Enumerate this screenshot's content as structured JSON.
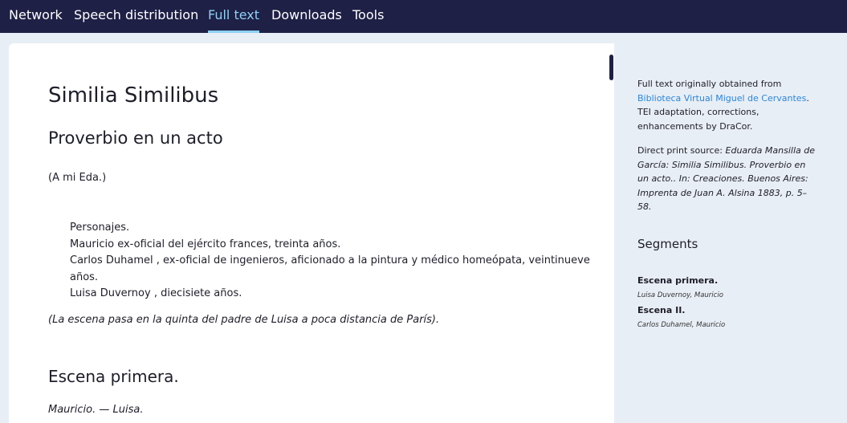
{
  "nav": {
    "tabs": [
      {
        "label": "Network"
      },
      {
        "label": "Speech distribution"
      },
      {
        "label": "Full text",
        "active": true
      },
      {
        "label": "Downloads"
      },
      {
        "label": "Tools"
      }
    ]
  },
  "play": {
    "title": "Similia Similibus",
    "subtitle": "Proverbio en un acto",
    "dedication": "(A mi Eda.)",
    "cast": [
      "Personajes.",
      "Mauricio ex-oficial del ejército frances, treinta años.",
      "Carlos Duhamel , ex-oficial de ingenieros, aficionado a la pintura y médico homeópata, veintinueve años.",
      "Luisa Duvernoy , diecisiete años."
    ],
    "set": "(La escena pasa en la quinta del padre de Luisa a poca distancia de París).",
    "scene_heading": "Escena primera.",
    "speakers": "Mauricio. — Luisa."
  },
  "source": {
    "intro": "Full text originally obtained from",
    "link": "Biblioteca Virtual Miguel de Cervantes",
    "after": ". TEI adaptation, corrections, enhancements by DraCor.",
    "print_label": "Direct print source: ",
    "print_source": "Eduarda Mansilla de García: Similia Similibus. Proverbio en un acto.. In: Creaciones. Buenos Aires: Imprenta de Juan A. Alsina 1883, p. 5–58."
  },
  "segments": {
    "title": "Segments",
    "items": [
      {
        "name": "Escena primera.",
        "speakers": "Luisa Duvernoy, Mauricio"
      },
      {
        "name": "Escena II.",
        "speakers": "Carlos Duhamel, Mauricio"
      }
    ]
  },
  "colors": {
    "nav_bg": "#1e2046",
    "active_tab": "#8fd0f3",
    "link": "#2a86d6",
    "panel_bg": "#e8eef5"
  }
}
